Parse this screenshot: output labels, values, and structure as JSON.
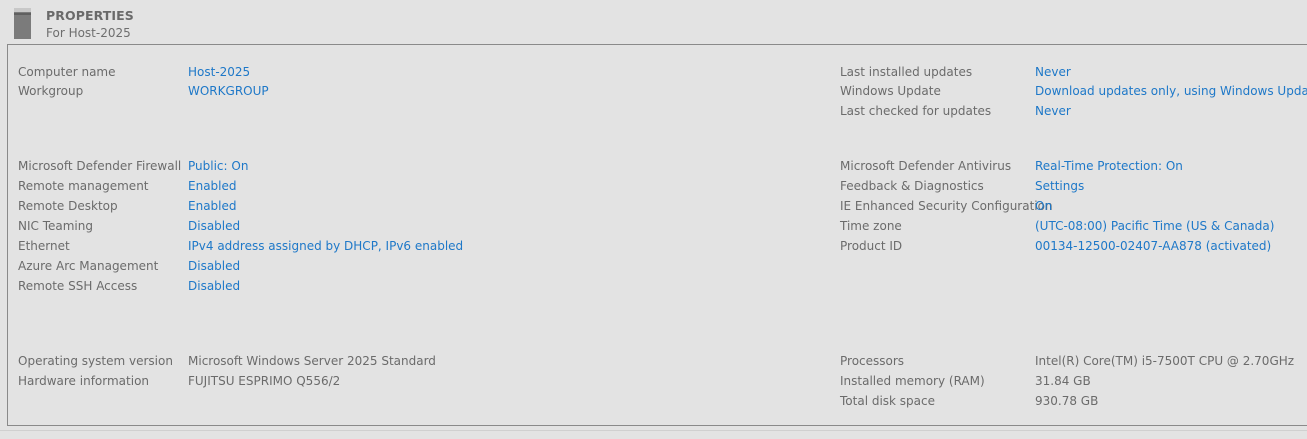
{
  "header": {
    "title": "PROPERTIES",
    "subtitle": "For Host-2025"
  },
  "left_group1": [
    {
      "label": "Computer name",
      "value": "Host-2025",
      "link": true
    },
    {
      "label": "Workgroup",
      "value": "WORKGROUP",
      "link": true
    }
  ],
  "left_group2": [
    {
      "label": "Microsoft Defender Firewall",
      "value": "Public: On",
      "link": true
    },
    {
      "label": "Remote management",
      "value": "Enabled",
      "link": true
    },
    {
      "label": "Remote Desktop",
      "value": "Enabled",
      "link": true
    },
    {
      "label": "NIC Teaming",
      "value": "Disabled",
      "link": true
    },
    {
      "label": "Ethernet",
      "value": "IPv4 address assigned by DHCP, IPv6 enabled",
      "link": true
    },
    {
      "label": "Azure Arc Management",
      "value": "Disabled",
      "link": true
    },
    {
      "label": "Remote SSH Access",
      "value": "Disabled",
      "link": true
    }
  ],
  "left_group3": [
    {
      "label": "Operating system version",
      "value": "Microsoft Windows Server 2025 Standard",
      "link": false
    },
    {
      "label": "Hardware information",
      "value": "FUJITSU ESPRIMO Q556/2",
      "link": false
    }
  ],
  "right_group1": [
    {
      "label": "Last installed updates",
      "value": "Never",
      "link": true
    },
    {
      "label": "Windows Update",
      "value": "Download updates only, using Windows Update",
      "link": true
    },
    {
      "label": "Last checked for updates",
      "value": "Never",
      "link": true
    }
  ],
  "right_group2": [
    {
      "label": "Microsoft Defender Antivirus",
      "value": "Real-Time Protection: On",
      "link": true
    },
    {
      "label": "Feedback & Diagnostics",
      "value": "Settings",
      "link": true
    },
    {
      "label": "IE Enhanced Security Configuration",
      "value": "On",
      "link": true
    },
    {
      "label": "Time zone",
      "value": "(UTC-08:00) Pacific Time (US & Canada)",
      "link": true
    },
    {
      "label": "Product ID",
      "value": "00134-12500-02407-AA878 (activated)",
      "link": true
    }
  ],
  "right_group3": [
    {
      "label": "Processors",
      "value": "Intel(R) Core(TM) i5-7500T CPU @ 2.70GHz",
      "link": false
    },
    {
      "label": "Installed memory (RAM)",
      "value": "31.84 GB",
      "link": false
    },
    {
      "label": "Total disk space",
      "value": "930.78 GB",
      "link": false
    }
  ],
  "colors": {
    "background": "#e3e3e3",
    "link": "#1e78c8",
    "label": "#6b6b6b",
    "border": "#8a8a8a"
  },
  "icons": {
    "header_icon": "server-icon"
  }
}
